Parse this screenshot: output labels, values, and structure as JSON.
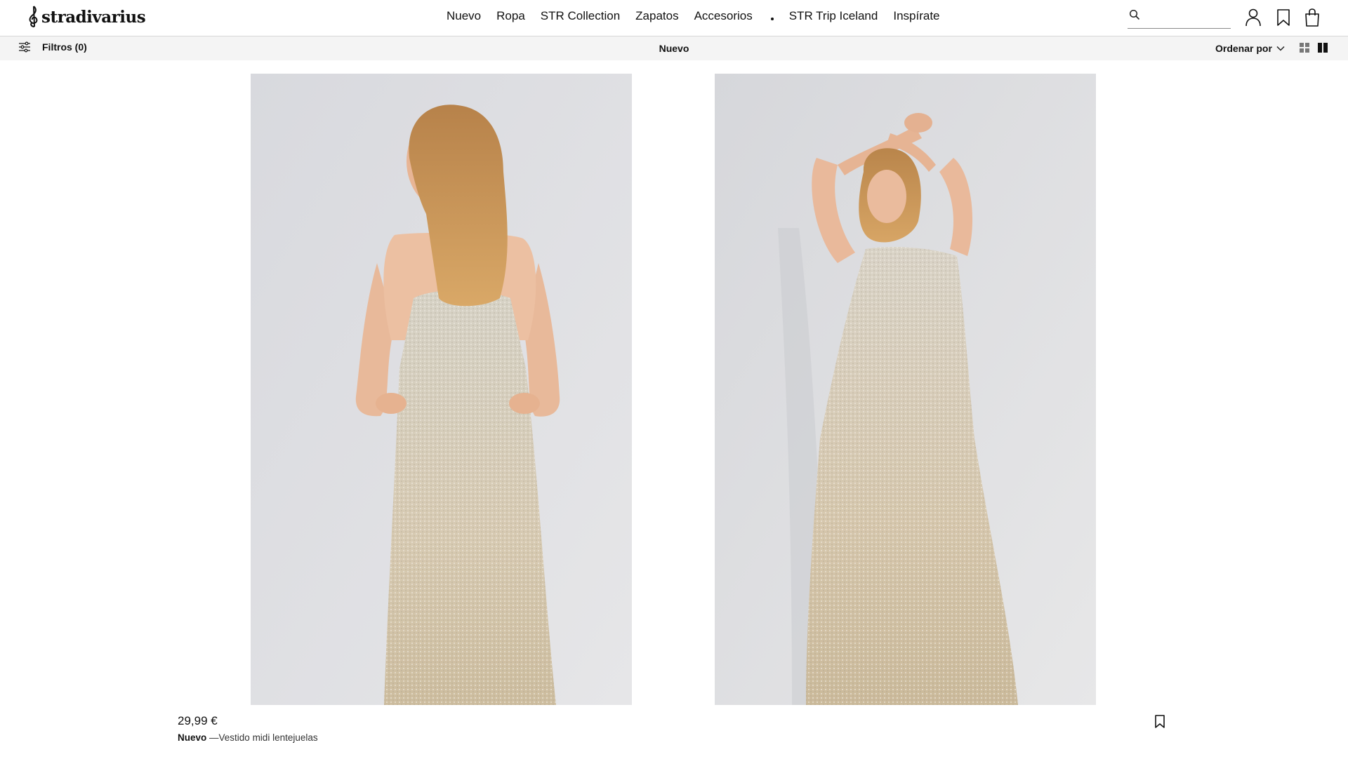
{
  "header": {
    "logo_text": "stradivarius",
    "nav": [
      "Nuevo",
      "Ropa",
      "STR Collection",
      "Zapatos",
      "Accesorios"
    ],
    "nav_after_dot": [
      "STR Trip Iceland",
      "Inspírate"
    ],
    "search": {
      "value": "",
      "placeholder": ""
    },
    "icons": [
      "search-icon",
      "user-icon",
      "bookmark-icon",
      "bag-icon"
    ]
  },
  "filterbar": {
    "filters_label": "Filtros (0)",
    "section_title": "Nuevo",
    "sort_label": "Ordenar por",
    "view_options": [
      "grid-four-icon",
      "grid-two-icon"
    ]
  },
  "product": {
    "price": "29,99 €",
    "badge": "Nuevo",
    "separator": " —",
    "name": "Vestido midi lentejuelas"
  },
  "colors": {
    "text": "#111111",
    "filter_bg": "#f4f4f4",
    "photo_bg": "#dcdde1",
    "dress": "#d9ccb5"
  }
}
